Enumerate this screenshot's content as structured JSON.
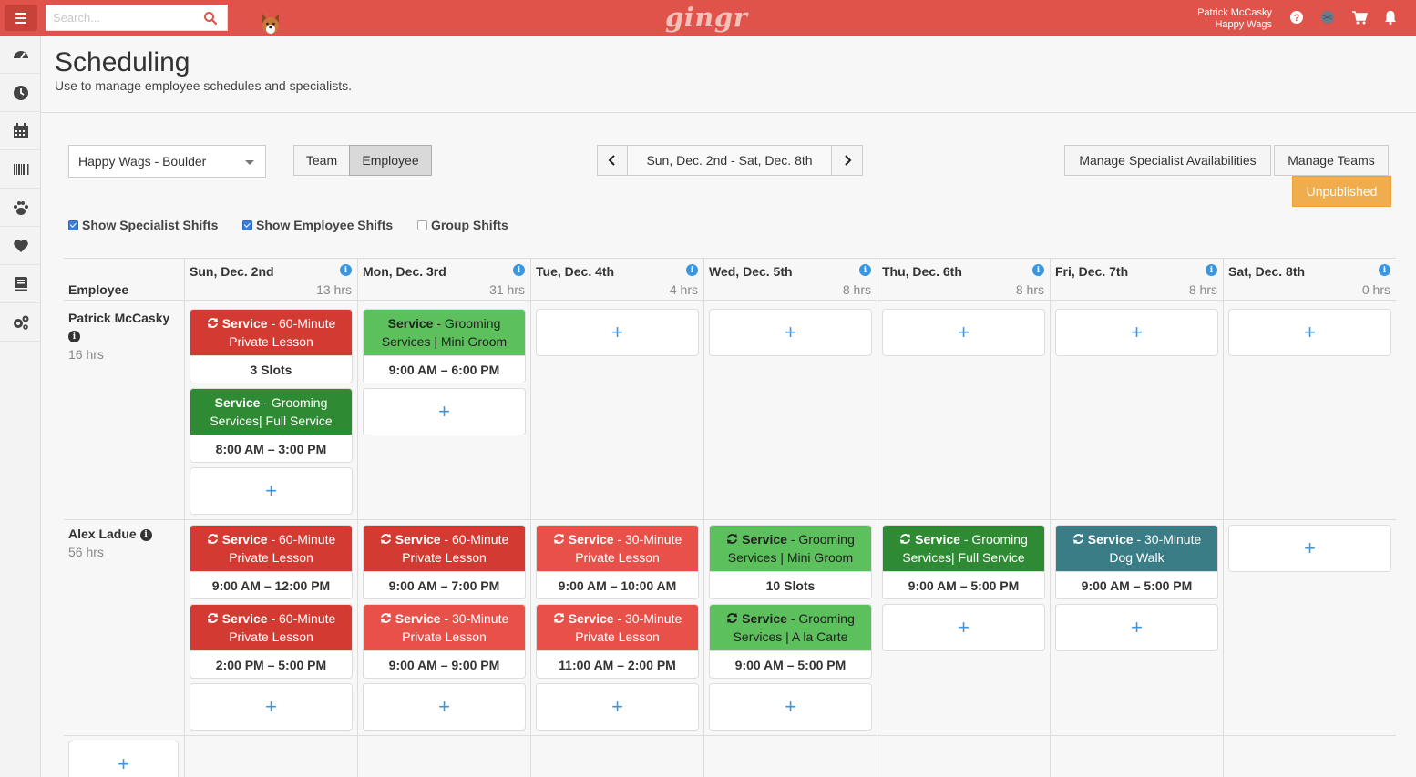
{
  "header": {
    "search_placeholder": "Search...",
    "brand": "gingr",
    "user_name": "Patrick McCasky",
    "business_name": "Happy Wags"
  },
  "page": {
    "title": "Scheduling",
    "subtitle": "Use to manage employee schedules and specialists."
  },
  "controls": {
    "location": "Happy Wags - Boulder",
    "view_team": "Team",
    "view_employee": "Employee",
    "date_range": "Sun, Dec. 2nd - Sat, Dec. 8th",
    "manage_specialists": "Manage Specialist Availabilities",
    "manage_teams": "Manage Teams",
    "unpublished": "Unpublished"
  },
  "filters": {
    "show_specialist": "Show Specialist Shifts",
    "show_employee": "Show Employee Shifts",
    "group_shifts": "Group Shifts"
  },
  "grid": {
    "employee_header": "Employee",
    "days": [
      {
        "name": "Sun, Dec. 2nd",
        "hrs": "13 hrs"
      },
      {
        "name": "Mon, Dec. 3rd",
        "hrs": "31 hrs"
      },
      {
        "name": "Tue, Dec. 4th",
        "hrs": "4 hrs"
      },
      {
        "name": "Wed, Dec. 5th",
        "hrs": "8 hrs"
      },
      {
        "name": "Thu, Dec. 6th",
        "hrs": "8 hrs"
      },
      {
        "name": "Fri, Dec. 7th",
        "hrs": "8 hrs"
      },
      {
        "name": "Sat, Dec. 8th",
        "hrs": "0 hrs"
      }
    ],
    "employees": [
      {
        "name": "Patrick McCasky",
        "hrs": "16 hrs"
      },
      {
        "name": "Alex Ladue",
        "hrs": "56 hrs"
      }
    ],
    "add": "+"
  },
  "shifts": {
    "service": "Service",
    "p_sun_1": {
      "line1": " - 60-Minute",
      "line2": "Private Lesson",
      "time": "3 Slots"
    },
    "p_sun_2": {
      "line1": " - Grooming",
      "line2": "Services| Full Service",
      "time": "8:00 AM – 3:00 PM"
    },
    "p_mon_1": {
      "line1": " - Grooming",
      "line2": "Services | Mini Groom",
      "time": "9:00 AM – 6:00 PM"
    },
    "a_sun_1": {
      "line1": " - 60-Minute",
      "line2": "Private Lesson",
      "time": "9:00 AM – 12:00 PM"
    },
    "a_sun_2": {
      "line1": " - 60-Minute",
      "line2": "Private Lesson",
      "time": "2:00 PM – 5:00 PM"
    },
    "a_mon_1": {
      "line1": " - 60-Minute",
      "line2": "Private Lesson",
      "time": "9:00 AM – 7:00 PM"
    },
    "a_mon_2": {
      "line1": " - 30-Minute",
      "line2": "Private Lesson",
      "time": "9:00 AM – 9:00 PM"
    },
    "a_tue_1": {
      "line1": " - 30-Minute",
      "line2": "Private Lesson",
      "time": "9:00 AM – 10:00 AM"
    },
    "a_tue_2": {
      "line1": " - 30-Minute",
      "line2": "Private Lesson",
      "time": "11:00 AM – 2:00 PM"
    },
    "a_wed_1": {
      "line1": " - Grooming",
      "line2": "Services | Mini Groom",
      "time": "10 Slots"
    },
    "a_wed_2": {
      "line1": " - Grooming",
      "line2": "Services | A la Carte",
      "time": "9:00 AM – 5:00 PM"
    },
    "a_thu_1": {
      "line1": " - Grooming",
      "line2": "Services| Full Service",
      "time": "9:00 AM – 5:00 PM"
    },
    "a_fri_1": {
      "line1": " - 30-Minute",
      "line2": "Dog Walk",
      "time": "9:00 AM – 5:00 PM"
    }
  },
  "colors": {
    "topbar": "#e0534a",
    "red": "#d33a32",
    "light_red": "#e8514a",
    "green": "#2e8b33",
    "light_green": "#5cc05c",
    "teal": "#3a7d86",
    "accent_blue": "#3b96e0",
    "orange": "#f0ad4e"
  }
}
